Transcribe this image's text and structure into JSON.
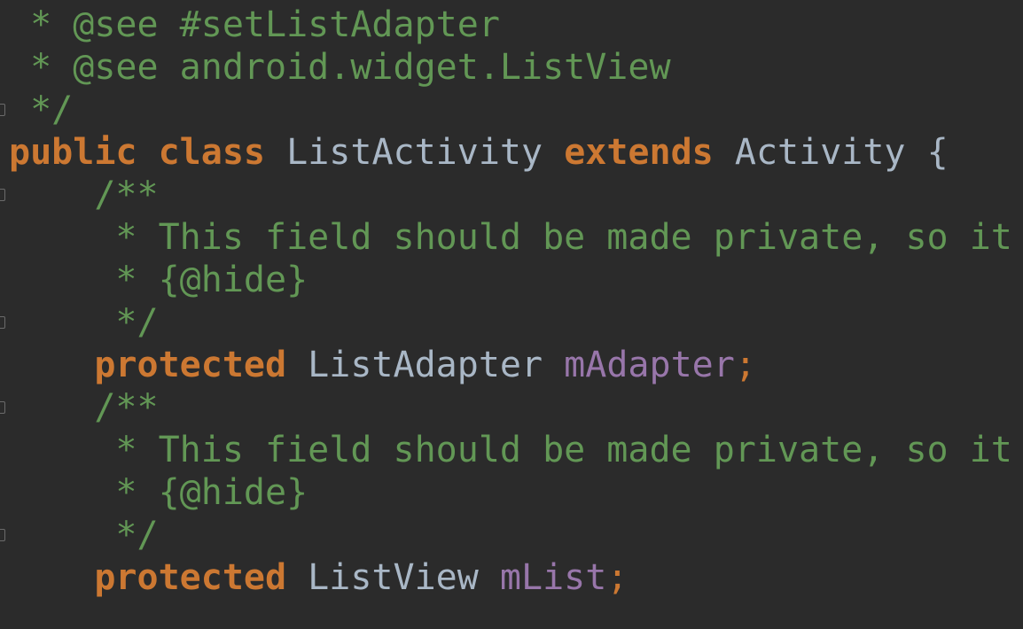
{
  "editor": {
    "lines": [
      {
        "indent": " ",
        "comment": "* @see #setListAdapter"
      },
      {
        "indent": " ",
        "comment": "* @see android.widget.ListView"
      },
      {
        "indent": " ",
        "comment": "*/"
      },
      {
        "kw_public": "public",
        "kw_class": "class",
        "class_name": "ListActivity",
        "kw_extends": "extends",
        "super_name": "Activity",
        "brace": "{"
      },
      {
        "indent": "    ",
        "comment": "/**"
      },
      {
        "indent": "     ",
        "comment": "* This field should be made private, so it"
      },
      {
        "indent": "     ",
        "comment": "* {@hide}"
      },
      {
        "indent": "     ",
        "comment": "*/"
      },
      {
        "indent": "    ",
        "kw_protected": "protected",
        "type": "ListAdapter",
        "field": "mAdapter",
        "semi": ";"
      },
      {
        "indent": "    ",
        "comment": "/**"
      },
      {
        "indent": "     ",
        "comment": "* This field should be made private, so it"
      },
      {
        "indent": "     ",
        "comment": "* {@hide}"
      },
      {
        "indent": "     ",
        "comment": "*/"
      },
      {
        "indent": "    ",
        "kw_protected": "protected",
        "type": "ListView",
        "field": "mList",
        "semi": ";"
      }
    ]
  },
  "colors": {
    "background": "#2b2b2b",
    "comment": "#629755",
    "keyword": "#cc7832",
    "identifier": "#a9b7c6",
    "field": "#9876aa"
  },
  "icons": {
    "fold_marker": "fold-marker-icon"
  }
}
